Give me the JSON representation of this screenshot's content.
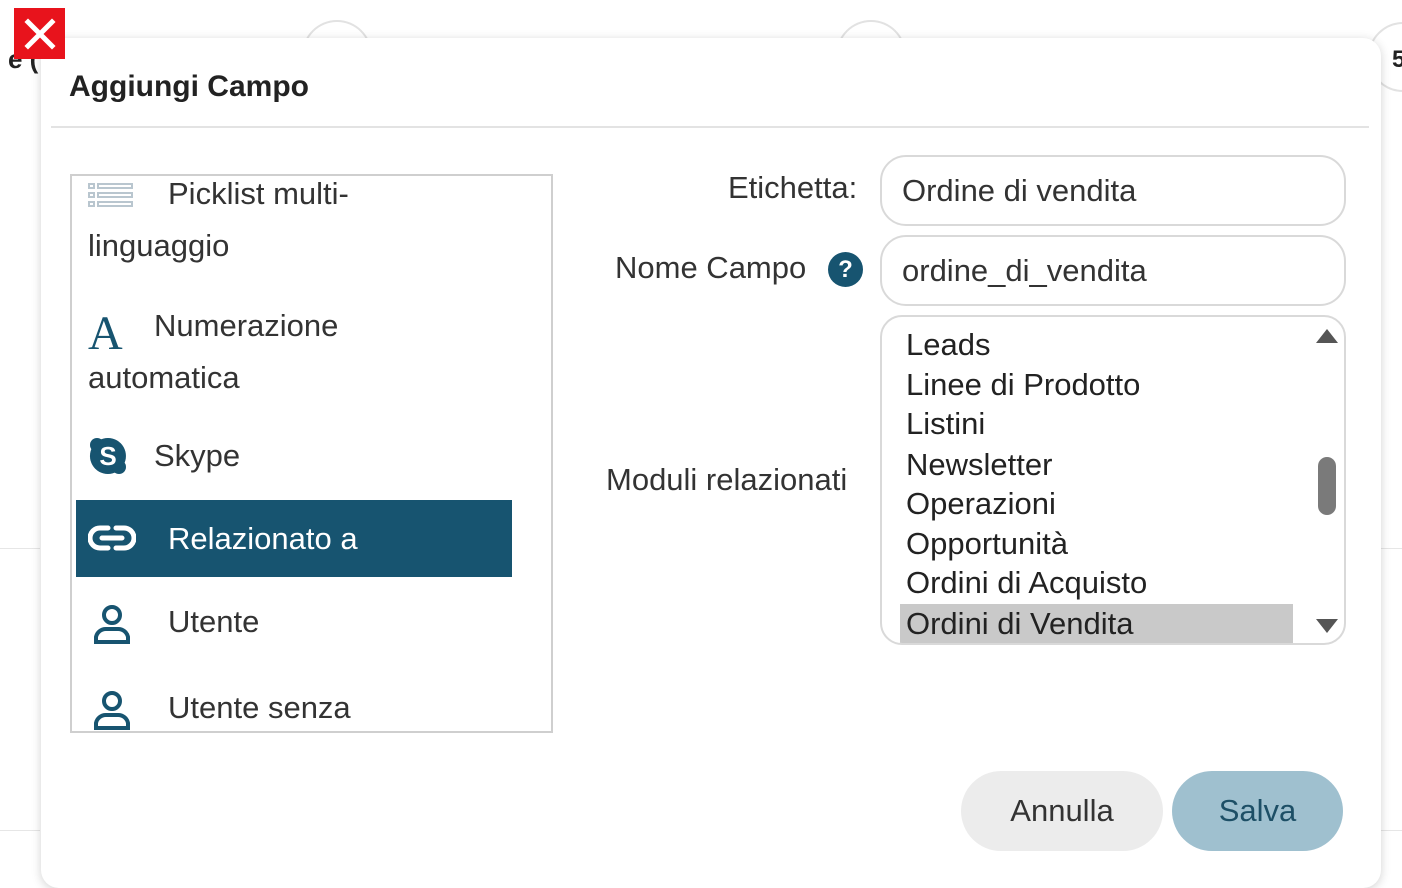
{
  "background": {
    "left_fragment": "e (",
    "right_fragment": "5"
  },
  "modal": {
    "title": "Aggiungi Campo",
    "close_icon": "close-icon"
  },
  "field_types": {
    "items": [
      {
        "icon": "multi-list-icon",
        "line1": "Picklist multi-",
        "line2": "linguaggio",
        "selected": false
      },
      {
        "icon": "letter-a-icon",
        "line1": "Numerazione",
        "line2": "automatica",
        "selected": false
      },
      {
        "icon": "skype-icon",
        "line1": "Skype",
        "line2": "",
        "selected": false
      },
      {
        "icon": "link-icon",
        "line1": "Relazionato a",
        "line2": "",
        "selected": true
      },
      {
        "icon": "user-icon",
        "line1": "Utente",
        "line2": "",
        "selected": false
      },
      {
        "icon": "user-icon",
        "line1": "Utente senza",
        "line2": "",
        "selected": false
      }
    ]
  },
  "form": {
    "label_field": {
      "label": "Etichetta:",
      "value": "Ordine di vendita"
    },
    "name_field": {
      "label": "Nome Campo",
      "value": "ordine_di_vendita",
      "help": "?"
    },
    "modules": {
      "label": "Moduli relazionati",
      "options": [
        "Leads",
        "Linee di Prodotto",
        "Listini",
        "Newsletter",
        "Operazioni",
        "Opportunità",
        "Ordini di Acquisto",
        "Ordini di Vendita"
      ],
      "selected": "Ordini di Vendita"
    }
  },
  "buttons": {
    "cancel": "Annulla",
    "save": "Salva"
  },
  "colors": {
    "accent": "#175470",
    "save_bg": "#9fc0cf",
    "close_red": "#e8131c"
  }
}
